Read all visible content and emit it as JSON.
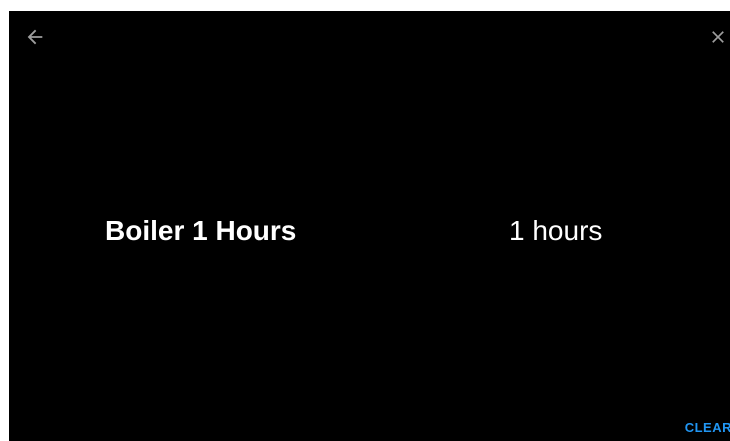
{
  "header": {
    "back_icon": "arrow-left-icon",
    "close_icon": "close-icon",
    "icon_color": "#9e9e9e"
  },
  "entity": {
    "name": "Boiler 1 Hours",
    "state": "1 hours"
  },
  "footer": {
    "clear_label": "CLEAR",
    "accent_color": "#2196f3"
  },
  "colors": {
    "background": "#000000",
    "text": "#ffffff"
  }
}
